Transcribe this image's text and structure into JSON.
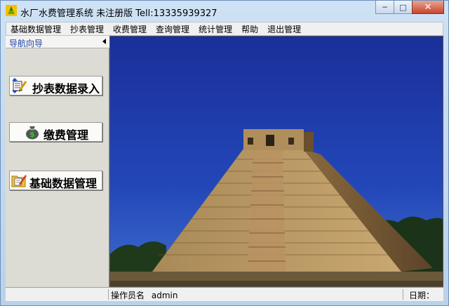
{
  "window": {
    "title": "水厂水费管理系统 未注册版 Tell:13335939327",
    "minimize_label": "─",
    "maximize_label": "□",
    "close_label": "✕"
  },
  "menu": {
    "items": [
      {
        "label": "基础数据管理"
      },
      {
        "label": "抄表管理"
      },
      {
        "label": "收费管理"
      },
      {
        "label": "查询管理"
      },
      {
        "label": "统计管理"
      },
      {
        "label": "帮助"
      },
      {
        "label": "退出管理"
      }
    ]
  },
  "nav": {
    "header": "导航向导",
    "buttons": [
      {
        "label": "抄表数据录入",
        "icon": "notebook-pencil-icon"
      },
      {
        "label": "缴费管理",
        "icon": "money-bag-icon"
      },
      {
        "label": "基础数据管理",
        "icon": "folder-edit-icon"
      }
    ]
  },
  "status": {
    "operator_label": "操作员名",
    "operator_value": "admin",
    "date_label": "日期："
  },
  "colors": {
    "sky": "#1d3ea8",
    "nav_bg": "#dcdcd4",
    "nav_header_text": "#1f3fa8"
  }
}
